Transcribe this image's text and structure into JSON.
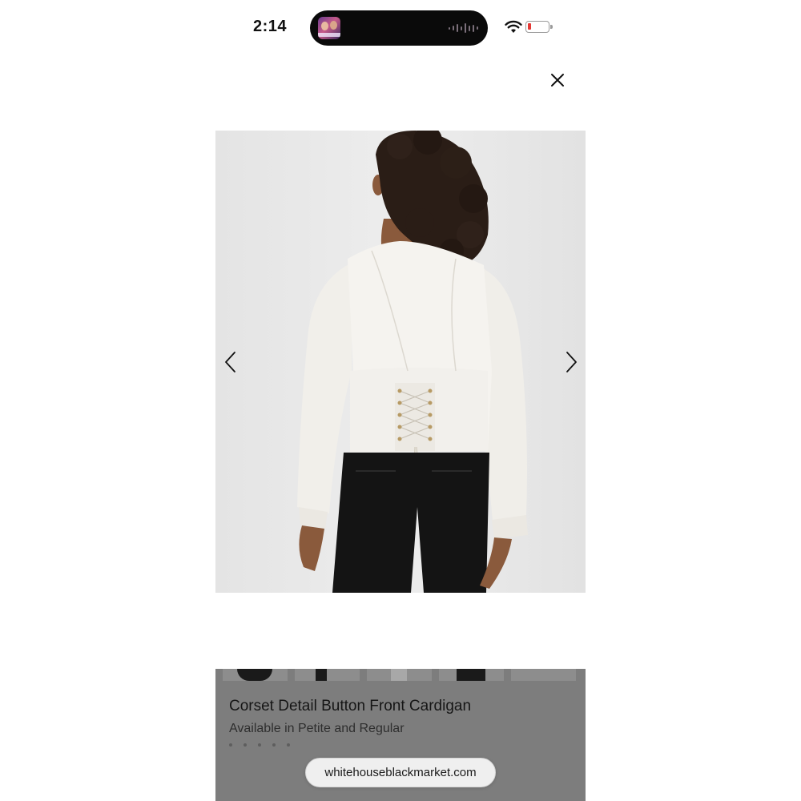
{
  "status_bar": {
    "time": "2:14"
  },
  "close_icon": "close-icon",
  "gallery": {
    "prev_icon": "chevron-left-icon",
    "next_icon": "chevron-right-icon"
  },
  "product": {
    "title": "Corset Detail Button Front Cardigan",
    "subtitle": "Available in Petite and Regular"
  },
  "browser": {
    "url": "whitehouseblackmarket.com"
  },
  "colors": {
    "overlay": "#7d7d7d",
    "sweater": "#f4f2ee",
    "pants": "#111111"
  }
}
